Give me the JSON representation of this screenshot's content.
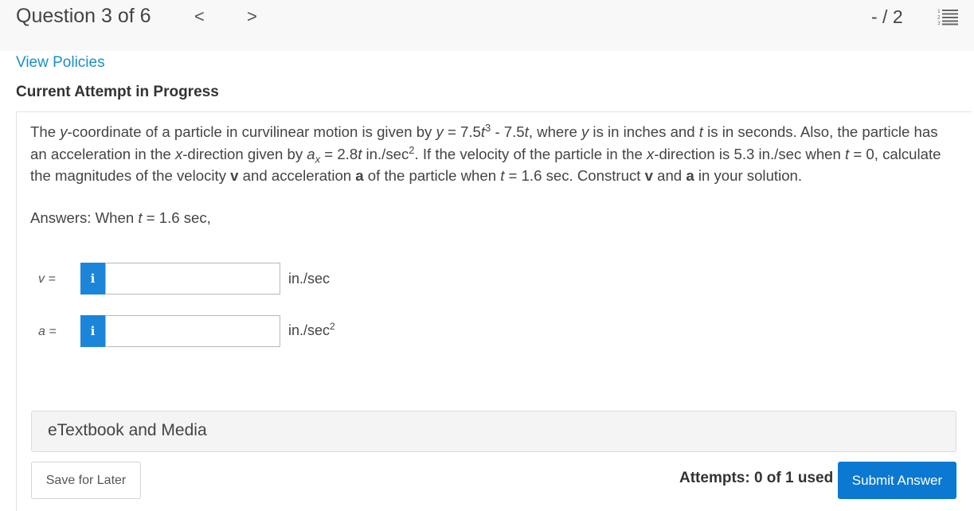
{
  "header": {
    "question_title": "Question 3 of 6",
    "prev_glyph": "<",
    "next_glyph": ">",
    "score": "- / 2",
    "list_icon": "numbered-list-icon"
  },
  "links": {
    "view_policies": "View Policies"
  },
  "attempt_heading": "Current Attempt in Progress",
  "problem": {
    "p1": "The ",
    "y1": "y",
    "p2": "-coordinate of a particle in curvilinear motion is given by ",
    "y2": "y",
    "p3": " = 7.5",
    "t1": "t",
    "exp3": "3",
    "p4": " - 7.5",
    "t2": "t",
    "p5": ", where ",
    "y3": "y",
    "p6": " is in inches and ",
    "t3": "t",
    "p7": " is in seconds. Also, the particle has an acceleration in the ",
    "x1": "x",
    "p8": "-direction given by ",
    "a1": "a",
    "subx": "x",
    "p9": " = 2.8",
    "t4": "t",
    "p10": " in./sec",
    "exp2a": "2",
    "p11": ". If the velocity of the particle in the ",
    "x2": "x",
    "p12": "-direction is 5.3 in./sec when ",
    "t5": "t",
    "p13": " = 0, calculate the magnitudes of the velocity ",
    "bv": "v",
    "p14": " and acceleration ",
    "ba": "a",
    "p15": " of the particle when ",
    "t6": "t",
    "p16": " = 1.6 sec. Construct ",
    "bv2": "v",
    "p17": " and ",
    "ba2": "a",
    "p18": " in your solution."
  },
  "answers": {
    "intro_pre": "Answers: When ",
    "intro_t": "t",
    "intro_post": " = 1.6 sec,",
    "fields": [
      {
        "label": "v =",
        "value": "",
        "unit": "in./sec",
        "unit_exp": ""
      },
      {
        "label": "a =",
        "value": "",
        "unit": "in./sec",
        "unit_exp": "2"
      }
    ],
    "info_glyph": "i"
  },
  "etextbook": "eTextbook and Media",
  "footer": {
    "save_label": "Save for Later",
    "attempts": "Attempts: 0 of 1 used",
    "submit_label": "Submit Answer"
  },
  "colors": {
    "link": "#1a8fc9",
    "info_button": "#1b86d9",
    "submit_button": "#0b78d1"
  }
}
